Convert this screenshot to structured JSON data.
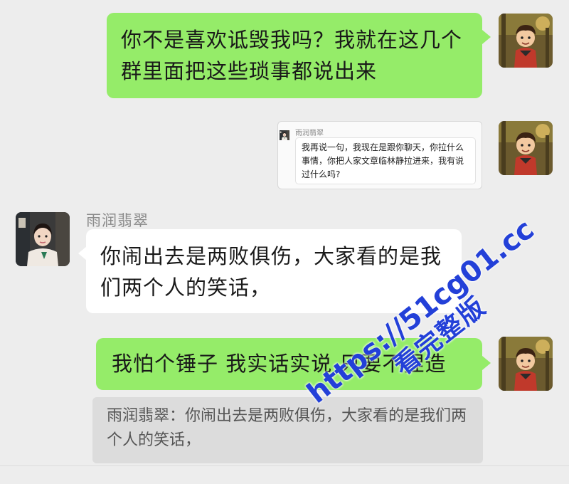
{
  "messages": {
    "m1": "你不是喜欢诋毁我吗？我就在这几个群里面把这些琐事都说出来",
    "m3": "你闹出去是两败俱伤，大家看的是我们两个人的笑话，",
    "m4": "我怕个锤子 我实话实说 只要不捏造"
  },
  "quoted_card": {
    "sender": "雨润翡翠",
    "text": "我再说一句，我现在是跟你聊天，你拉什么事情，你把人家文章临林静拉进来，我有说过什么吗?"
  },
  "contact": {
    "name": "雨润翡翠"
  },
  "reply_quote": {
    "text": "雨润翡翠：你闹出去是两败俱伤，大家看的是我们两个人的笑话，"
  },
  "watermark": {
    "url": "https://51cg01.cc",
    "sub": "看完整版"
  },
  "colors": {
    "background": "#ededed",
    "sent_bubble": "#95ec69",
    "received_bubble": "#ffffff",
    "watermark": "#2340d8"
  },
  "icons": [
    "self-avatar",
    "contact-avatar"
  ]
}
